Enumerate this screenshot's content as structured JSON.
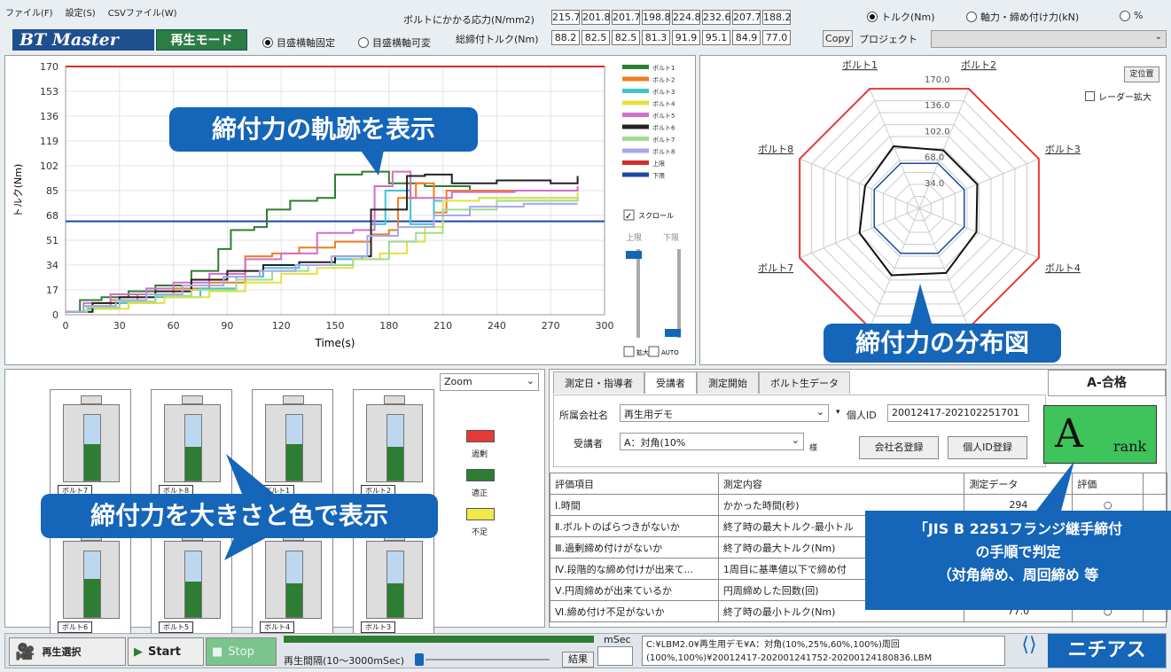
{
  "menu": [
    "ファイル(F)",
    "設定(S)",
    "CSVファイル(W)"
  ],
  "stress": {
    "label": "ボルトにかかる応力(N/mm2)",
    "values": [
      "215.7",
      "201.8",
      "201.7",
      "198.8",
      "224.8",
      "232.6",
      "207.7",
      "188.2"
    ]
  },
  "torque": {
    "label": "総締付トルク(Nm)",
    "values": [
      "88.2",
      "82.5",
      "82.5",
      "81.3",
      "91.9",
      "95.1",
      "84.9",
      "77.0"
    ],
    "copy": "Copy"
  },
  "unit_radios": [
    {
      "label": "トルク(Nm)",
      "on": true
    },
    {
      "label": "軸力・締め付け力(kN)",
      "on": false
    },
    {
      "label": "%",
      "on": false
    }
  ],
  "project": {
    "label": "プロジェクト",
    "value": ""
  },
  "app": {
    "logo": "BT Master",
    "mode": "再生モード"
  },
  "scale_radios": [
    {
      "label": "目盛横軸固定",
      "on": true
    },
    {
      "label": "目盛横軸可変",
      "on": false
    }
  ],
  "callouts": {
    "trajectory": "締付力の軌跡を表示",
    "distribution": "締付力の分布図",
    "size_color": "締付力を大きさと色で表示",
    "jis": [
      "「JIS B 2251フランジ継手締付",
      "の手順で判定",
      "（対角締め、周回締め 等"
    ]
  },
  "chart_data": {
    "type": "line",
    "xlabel": "Time(s)",
    "ylabel": "トルク(Nm)",
    "xlim": [
      0,
      300
    ],
    "ylim": [
      0,
      170
    ],
    "xticks": [
      0,
      30,
      60,
      90,
      120,
      150,
      180,
      210,
      240,
      270,
      300
    ],
    "yticks": [
      0,
      17,
      34,
      51,
      68,
      85,
      102,
      119,
      136,
      153,
      170
    ],
    "upper_limit": 170,
    "lower_limit": 64,
    "series": [
      {
        "name": "ボルト1",
        "color": "#2e7d32",
        "points": [
          [
            0,
            2
          ],
          [
            8,
            10
          ],
          [
            20,
            12
          ],
          [
            35,
            16
          ],
          [
            50,
            20
          ],
          [
            70,
            30
          ],
          [
            85,
            45
          ],
          [
            92,
            58
          ],
          [
            105,
            60
          ],
          [
            112,
            72
          ],
          [
            125,
            78
          ],
          [
            140,
            80
          ],
          [
            150,
            96
          ],
          [
            165,
            98
          ],
          [
            180,
            90
          ],
          [
            200,
            88
          ],
          [
            225,
            85
          ],
          [
            285,
            85
          ]
        ]
      },
      {
        "name": "ボルト2",
        "color": "#ef7d22",
        "points": [
          [
            0,
            2
          ],
          [
            10,
            6
          ],
          [
            25,
            10
          ],
          [
            40,
            14
          ],
          [
            60,
            18
          ],
          [
            80,
            22
          ],
          [
            100,
            40
          ],
          [
            115,
            42
          ],
          [
            130,
            46
          ],
          [
            150,
            50
          ],
          [
            170,
            55
          ],
          [
            180,
            58
          ],
          [
            185,
            80
          ],
          [
            195,
            90
          ],
          [
            205,
            70
          ],
          [
            212,
            85
          ],
          [
            240,
            85
          ],
          [
            285,
            86
          ]
        ]
      },
      {
        "name": "ボルト3",
        "color": "#41c4d1",
        "points": [
          [
            0,
            2
          ],
          [
            12,
            4
          ],
          [
            30,
            8
          ],
          [
            50,
            12
          ],
          [
            75,
            18
          ],
          [
            95,
            26
          ],
          [
            110,
            32
          ],
          [
            130,
            34
          ],
          [
            150,
            38
          ],
          [
            165,
            40
          ],
          [
            170,
            62
          ],
          [
            178,
            85
          ],
          [
            192,
            62
          ],
          [
            205,
            78
          ],
          [
            230,
            80
          ],
          [
            285,
            82
          ]
        ]
      },
      {
        "name": "ボルト4",
        "color": "#e6e042",
        "points": [
          [
            0,
            2
          ],
          [
            15,
            4
          ],
          [
            35,
            8
          ],
          [
            55,
            12
          ],
          [
            80,
            16
          ],
          [
            100,
            22
          ],
          [
            120,
            28
          ],
          [
            140,
            32
          ],
          [
            160,
            38
          ],
          [
            175,
            42
          ],
          [
            190,
            50
          ],
          [
            200,
            60
          ],
          [
            210,
            78
          ],
          [
            230,
            80
          ],
          [
            285,
            84
          ]
        ]
      },
      {
        "name": "ボルト5",
        "color": "#d16fca",
        "points": [
          [
            0,
            2
          ],
          [
            10,
            8
          ],
          [
            25,
            14
          ],
          [
            45,
            18
          ],
          [
            60,
            22
          ],
          [
            80,
            28
          ],
          [
            100,
            38
          ],
          [
            120,
            42
          ],
          [
            140,
            56
          ],
          [
            160,
            58
          ],
          [
            172,
            88
          ],
          [
            182,
            98
          ],
          [
            192,
            80
          ],
          [
            215,
            84
          ],
          [
            250,
            85
          ],
          [
            285,
            88
          ]
        ]
      },
      {
        "name": "ボルト6",
        "color": "#222222",
        "points": [
          [
            0,
            2
          ],
          [
            15,
            8
          ],
          [
            30,
            12
          ],
          [
            50,
            16
          ],
          [
            70,
            24
          ],
          [
            90,
            30
          ],
          [
            110,
            34
          ],
          [
            130,
            36
          ],
          [
            150,
            40
          ],
          [
            170,
            72
          ],
          [
            190,
            95
          ],
          [
            200,
            96
          ],
          [
            215,
            90
          ],
          [
            240,
            92
          ],
          [
            270,
            90
          ],
          [
            285,
            95
          ]
        ]
      },
      {
        "name": "ボルト7",
        "color": "#9fdc8f",
        "points": [
          [
            0,
            2
          ],
          [
            12,
            5
          ],
          [
            30,
            9
          ],
          [
            50,
            13
          ],
          [
            70,
            17
          ],
          [
            95,
            24
          ],
          [
            115,
            30
          ],
          [
            135,
            34
          ],
          [
            160,
            38
          ],
          [
            180,
            50
          ],
          [
            195,
            56
          ],
          [
            210,
            72
          ],
          [
            240,
            78
          ],
          [
            285,
            80
          ]
        ]
      },
      {
        "name": "ボルト8",
        "color": "#a8a7e8",
        "points": [
          [
            0,
            2
          ],
          [
            10,
            6
          ],
          [
            28,
            10
          ],
          [
            45,
            14
          ],
          [
            65,
            20
          ],
          [
            88,
            26
          ],
          [
            108,
            30
          ],
          [
            128,
            34
          ],
          [
            148,
            40
          ],
          [
            168,
            54
          ],
          [
            185,
            60
          ],
          [
            205,
            68
          ],
          [
            225,
            74
          ],
          [
            255,
            76
          ],
          [
            285,
            76
          ]
        ]
      }
    ]
  },
  "legend_extra": [
    {
      "name": "上限",
      "color": "#d32f2f"
    },
    {
      "name": "下限",
      "color": "#1a47a6"
    }
  ],
  "scroll": {
    "label": "スクロール",
    "upper": "上限",
    "lower": "下限",
    "zoom": "拡大",
    "auto": "AUTO"
  },
  "radar": {
    "labels": [
      "ボルト1",
      "ボルト2",
      "ボルト3",
      "ボルト4",
      "ボルト5",
      "ボルト6",
      "ボルト7",
      "ボルト8"
    ],
    "rings": [
      "34.0",
      "68.0",
      "102.0",
      "136.0",
      "170.0"
    ],
    "max": 170,
    "upper": 170,
    "lower": 64,
    "values": [
      88.2,
      82.5,
      82.5,
      81.3,
      91.9,
      95.1,
      84.9,
      77.0
    ],
    "reset": "定位置",
    "enlarge": "レーダー拡大"
  },
  "gauges": {
    "zoom": "Zoom",
    "items": [
      {
        "name": "ボルト7",
        "level": 0.55
      },
      {
        "name": "ボルト8",
        "level": 0.52
      },
      {
        "name": "ボルト1",
        "level": 0.55
      },
      {
        "name": "ボルト2",
        "level": 0.52
      },
      {
        "name": "ボルト6",
        "level": 0.58
      },
      {
        "name": "ボルト5",
        "level": 0.54
      },
      {
        "name": "ボルト4",
        "level": 0.52
      },
      {
        "name": "ボルト3",
        "level": 0.52
      }
    ],
    "legend": [
      {
        "label": "過剰",
        "color": "#e53935"
      },
      {
        "label": "適正",
        "color": "#2e7d32"
      },
      {
        "label": "不足",
        "color": "#f1e84a"
      }
    ]
  },
  "tabs": [
    "測定日・指導者",
    "受講者",
    "測定開始",
    "ボルト生データ"
  ],
  "form": {
    "company_label": "所属会社名",
    "company": "再生用デモ",
    "id_label": "個人ID",
    "id": "20012417-202102251701",
    "student_label": "受講者",
    "student": "A：対角(10%",
    "sama": "様",
    "register_company": "会社名登録",
    "register_id": "個人ID登録"
  },
  "result": {
    "title": "A-合格",
    "grade": "A",
    "rank": "rank"
  },
  "eval": {
    "headers": [
      "評価項目",
      "測定内容",
      "測定データ",
      "評価"
    ],
    "rows": [
      [
        "Ⅰ.時間",
        "かかった時間(秒)",
        "294",
        "○"
      ],
      [
        "Ⅱ.ボルトのばらつきがないか",
        "終了時の最大トルク-最小トル",
        "",
        ""
      ],
      [
        "Ⅲ.過剰締め付けがないか",
        "終了時の最大トルク(Nm)",
        "",
        ""
      ],
      [
        "Ⅳ.段階的な締め付けが出来て...",
        "1周目に基準値以下で締め付",
        "",
        ""
      ],
      [
        "Ⅴ.円周締めが出来ているか",
        "円周締めした回数(回)",
        "",
        ""
      ],
      [
        "Ⅵ.締め付け不足がないか",
        "終了時の最小トルク(Nm)",
        "77.0",
        "○"
      ]
    ]
  },
  "bottom": {
    "select": "再生選択",
    "start": "Start",
    "stop": "Stop",
    "interval": "再生間隔(10～3000mSec)",
    "msec": "mSec",
    "result": "結果",
    "path1": "C:¥LBM2.0¥再生用デモ¥A：対角(10%,25%,60%,100%)周回",
    "path2": "(100%,100%)¥20012417-202001241752-20200124180836.LBM",
    "brand": "ニチアス"
  }
}
